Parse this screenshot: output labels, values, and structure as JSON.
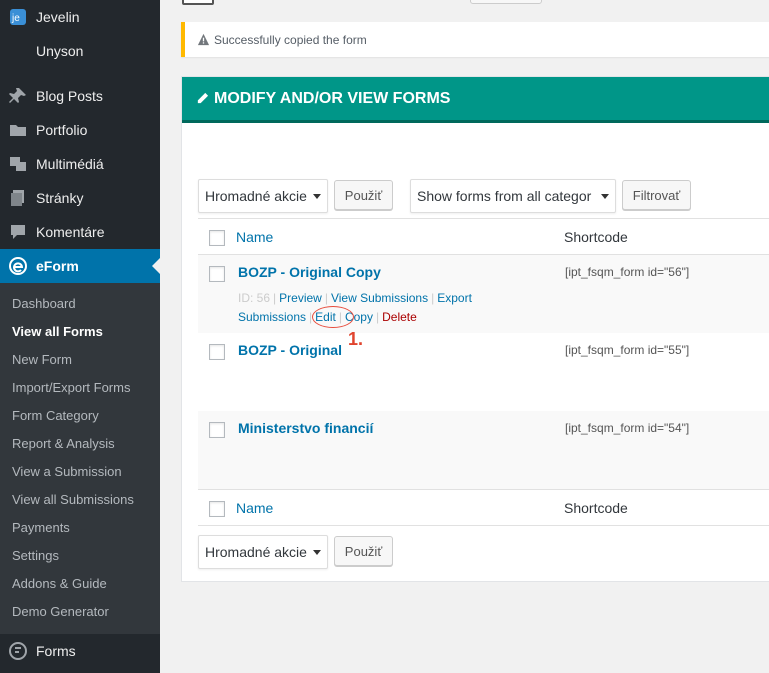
{
  "sidebar": {
    "top_items": [
      {
        "label": "Jevelin",
        "icon": "jevelin-logo-icon"
      },
      {
        "label": "Unyson",
        "icon": ""
      },
      {
        "label": "Blog Posts",
        "icon": "pin-icon"
      },
      {
        "label": "Portfolio",
        "icon": "folder-icon"
      },
      {
        "label": "Multimédiá",
        "icon": "media-icon"
      },
      {
        "label": "Stránky",
        "icon": "pages-icon"
      },
      {
        "label": "Komentáre",
        "icon": "comment-icon"
      },
      {
        "label": "eForm",
        "icon": "eform-icon"
      }
    ],
    "submenu": [
      "Dashboard",
      "View all Forms",
      "New Form",
      "Import/Export Forms",
      "Form Category",
      "Report & Analysis",
      "View a Submission",
      "View all Submissions",
      "Payments",
      "Settings",
      "Addons & Guide",
      "Demo Generator"
    ],
    "bottom_item": {
      "label": "Forms",
      "icon": "forms-icon"
    }
  },
  "notice": {
    "text": "Successfully copied the form",
    "icon": "warning-icon"
  },
  "panel": {
    "title": "MODIFY AND/OR VIEW FORMS",
    "bulk_actions": "Hromadné akcie",
    "apply": "Použiť",
    "category_filter": "Show forms from all categor",
    "filter": "Filtrovať"
  },
  "table": {
    "columns": [
      "Name",
      "Shortcode"
    ],
    "rows": [
      {
        "title": "BOZP - Original Copy",
        "shortcode": "[ipt_fsqm_form id=\"56\"]"
      },
      {
        "title": "BOZP - Original",
        "shortcode": "[ipt_fsqm_form id=\"55\"]"
      },
      {
        "title": "Ministerstvo financií",
        "shortcode": "[ipt_fsqm_form id=\"54\"]"
      }
    ],
    "row_actions": {
      "id": "ID: 56",
      "preview": "Preview",
      "view_submissions": "View Submissions",
      "export": "Export",
      "submissions": "Submissions",
      "edit": "Edit",
      "copy": "Copy",
      "delete": "Delete"
    }
  },
  "annotation": {
    "number": "1.",
    "color": "#e74c3c"
  },
  "colors": {
    "sidebar": "#23282d",
    "accent": "#0073aa",
    "panel_header": "#009688",
    "notice_border": "#ffb900"
  }
}
